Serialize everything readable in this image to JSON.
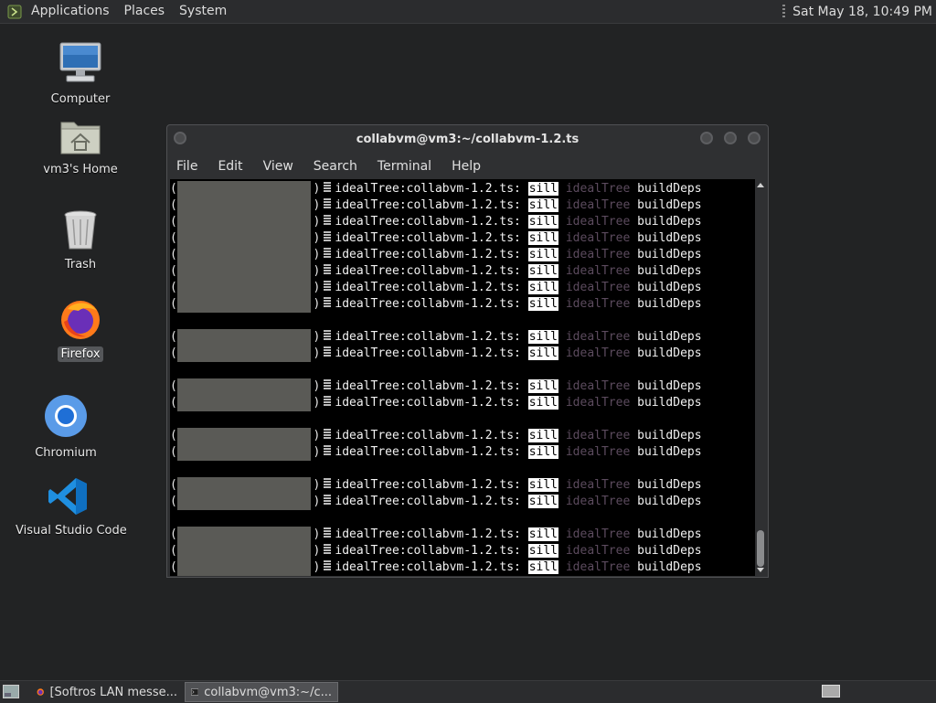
{
  "top_panel": {
    "menus": [
      "Applications",
      "Places",
      "System"
    ],
    "clock": "Sat May 18, 10:49 PM"
  },
  "desktop": {
    "icons": [
      {
        "label": "Computer",
        "icon": "computer-icon"
      },
      {
        "label": "vm3's Home",
        "icon": "home-folder-icon"
      },
      {
        "label": "Trash",
        "icon": "trash-icon"
      },
      {
        "label": "Firefox",
        "icon": "firefox-icon",
        "selected": true
      },
      {
        "label": "Chromium",
        "icon": "chromium-icon"
      },
      {
        "label": "Visual Studio Code",
        "icon": "vscode-icon"
      }
    ]
  },
  "terminal": {
    "title": "collabvm@vm3:~/collabvm-1.2.ts",
    "menu": [
      "File",
      "Edit",
      "View",
      "Search",
      "Terminal",
      "Help"
    ],
    "line_parts": {
      "open": "(",
      "close": ")",
      "prefix": "idealTree:collabvm-1.2.ts:",
      "level": "sill",
      "tag": "idealTree",
      "msg": "buildDeps"
    },
    "line_groups": [
      8,
      2,
      2,
      2,
      2,
      3
    ]
  },
  "taskbar": {
    "tasks": [
      {
        "label": "[Softros LAN messe...",
        "icon": "firefox-icon",
        "active": false
      },
      {
        "label": "collabvm@vm3:~/c...",
        "icon": "terminal-icon",
        "active": true
      }
    ]
  },
  "colors": {
    "desktop_bg": "#222324",
    "panel_bg": "#2b2c2e",
    "terminal_bg": "#000000",
    "sill_highlight": "#ffffff",
    "idealtree_dim": "#5c4b5e",
    "redaction": "#5a5a56"
  }
}
